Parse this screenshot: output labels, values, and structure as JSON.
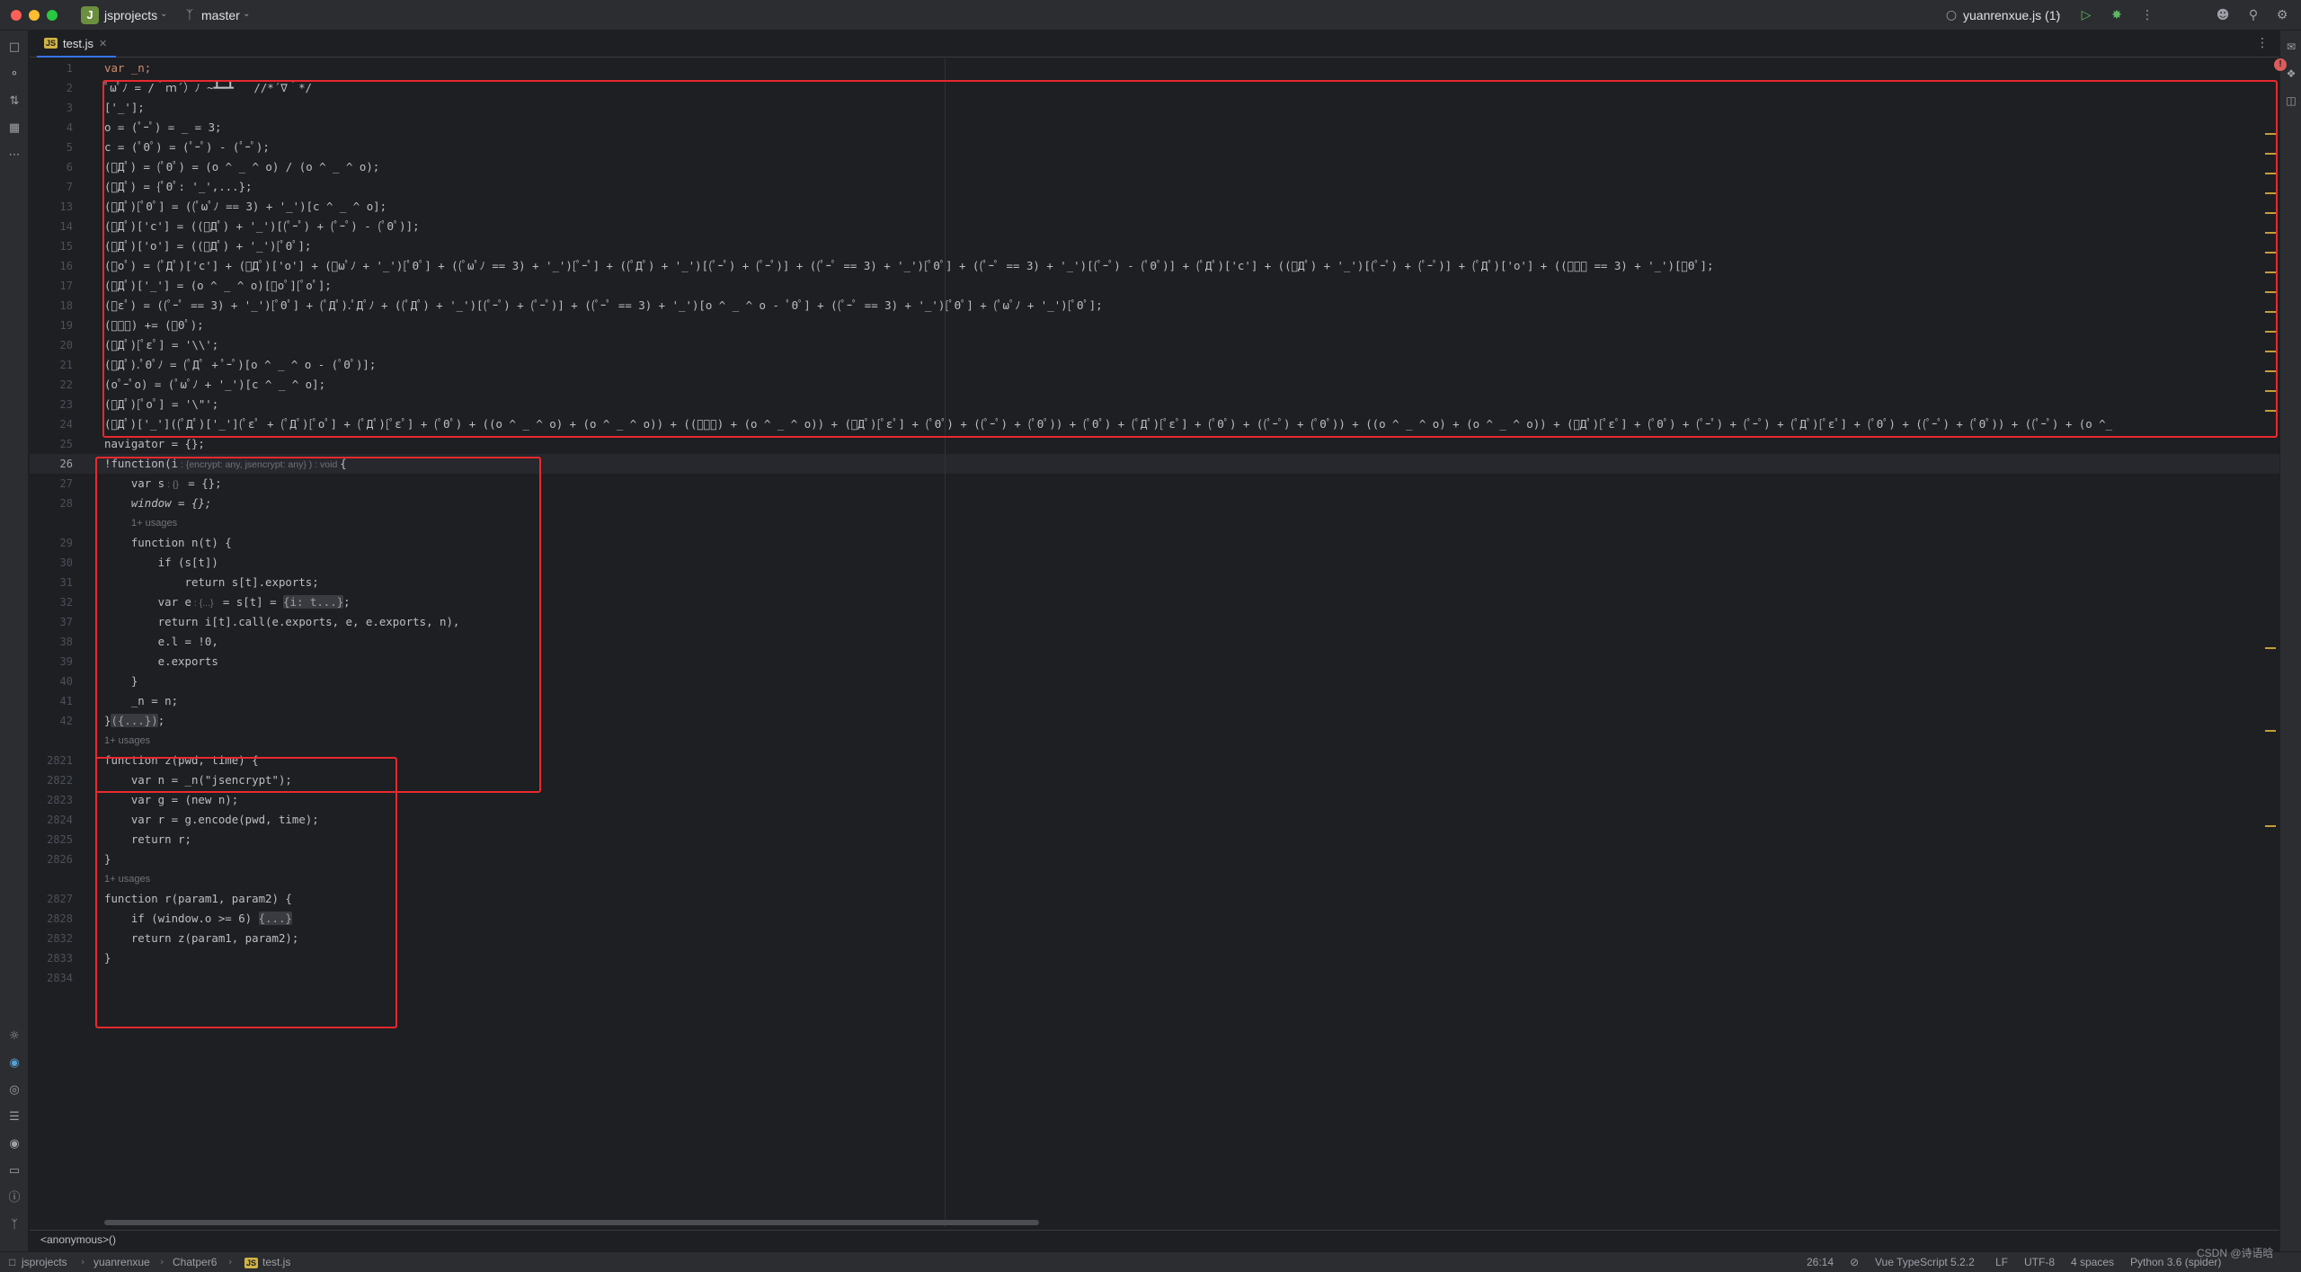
{
  "titlebar": {
    "project_badge": "J",
    "project_name": "jsprojects",
    "branch": "master",
    "run_config": "yuanrenxue.js (1)"
  },
  "tab": {
    "badge": "JS",
    "label": "test.js"
  },
  "breadcrumb_footer": "<anonymous>()",
  "status": {
    "path": [
      "jsprojects",
      "yuanrenxue",
      "Chatper6",
      "test.js"
    ],
    "position": "26:14",
    "language": "Vue TypeScript 5.2.2",
    "line_sep": "LF",
    "encoding": "UTF-8",
    "indent": "4 spaces",
    "interpreter": "Python 3.6 (spider)",
    "watermark": "CSDN @诗语晗"
  },
  "error_count": "!",
  "line_numbers": [
    "1",
    "2",
    "3",
    "4",
    "5",
    "6",
    "7",
    "13",
    "14",
    "15",
    "16",
    "17",
    "18",
    "19",
    "20",
    "21",
    "22",
    "23",
    "24",
    "25",
    "26",
    "27",
    "28",
    "29",
    "30",
    "31",
    "32",
    "37",
    "38",
    "39",
    "40",
    "41",
    "42",
    "2821",
    "2822",
    "2823",
    "2824",
    "2825",
    "2826",
    "2827",
    "2828",
    "2832",
    "2833",
    "2834"
  ],
  "code": {
    "l1": "var _n;",
    "l2": "ﾟωﾟﾉ = /｀ｍ´）ﾉ ~┻━┻   //*´∇｀*/",
    "l3": "['_'];",
    "l4": "o = (ﾟｰﾟ) = _ = 3;",
    "l5": "c = (ﾟΘﾟ) = (ﾟｰﾟ) - (ﾟｰﾟ);",
    "l6": "(ﾟДﾟ) = (ﾟΘﾟ) = (o ^ _ ^ o) / (o ^ _ ^ o);",
    "l7": "(ﾟДﾟ) = {ﾟΘﾟ: '_',...};",
    "l13": "(ﾟДﾟ)[ﾟΘﾟ] = ((ﾟωﾟﾉ == 3) + '_')[c ^ _ ^ o];",
    "l14": "(ﾟДﾟ)['c'] = ((ﾟДﾟ) + '_')[(ﾟｰﾟ) + (ﾟｰﾟ) - (ﾟΘﾟ)];",
    "l15": "(ﾟДﾟ)['o'] = ((ﾟДﾟ) + '_')[ﾟΘﾟ];",
    "l16": "(ﾟoﾟ) = (ﾟДﾟ)['c'] + (ﾟДﾟ)['o'] + (ﾟωﾟﾉ + '_')[ﾟΘﾟ] + ((ﾟωﾟﾉ == 3) + '_')[ﾟｰﾟ] + ((ﾟДﾟ) + '_')[(ﾟｰﾟ) + (ﾟｰﾟ)] + ((ﾟｰﾟ == 3) + '_')[ﾟΘﾟ] + ((ﾟｰﾟ == 3) + '_')[(ﾟｰﾟ) - (ﾟΘﾟ)] + (ﾟДﾟ)['c'] + ((ﾟДﾟ) + '_')[(ﾟｰﾟ) + (ﾟｰﾟ)] + (ﾟДﾟ)['o'] + ((ﾟｰﾟ == 3) + '_')[ﾟΘﾟ];",
    "l17": "(ﾟДﾟ)['_'] = (o ^ _ ^ o)[ﾟoﾟ][ﾟoﾟ];",
    "l18": "(ﾟεﾟ) = ((ﾟｰﾟ == 3) + '_')[ﾟΘﾟ] + (ﾟДﾟ).ﾟДﾟﾉ + ((ﾟДﾟ) + '_')[(ﾟｰﾟ) + (ﾟｰﾟ)] + ((ﾟｰﾟ == 3) + '_')[o ^ _ ^ o - ﾟΘﾟ] + ((ﾟｰﾟ == 3) + '_')[ﾟΘﾟ] + (ﾟωﾟﾉ + '_')[ﾟΘﾟ];",
    "l19": "(ﾟｰﾟ) += (ﾟΘﾟ);",
    "l20": "(ﾟДﾟ)[ﾟεﾟ] = '\\\\';",
    "l21": "(ﾟДﾟ).ﾟΘﾟﾉ = (ﾟДﾟ + ﾟｰﾟ)[o ^ _ ^ o - (ﾟΘﾟ)];",
    "l22": "(oﾟｰﾟo) = (ﾟωﾟﾉ + '_')[c ^ _ ^ o];",
    "l23": "(ﾟДﾟ)[ﾟoﾟ] = '\\\"';",
    "l24": "(ﾟДﾟ)['_']((ﾟДﾟ)['_'](ﾟεﾟ + (ﾟДﾟ)[ﾟoﾟ] + (ﾟДﾟ)[ﾟεﾟ] + (ﾟΘﾟ) + ((o ^ _ ^ o) + (o ^ _ ^ o)) + ((ﾟｰﾟ) + (o ^ _ ^ o)) + (ﾟДﾟ)[ﾟεﾟ] + (ﾟΘﾟ) + ((ﾟｰﾟ) + (ﾟΘﾟ)) + (ﾟΘﾟ) + (ﾟДﾟ)[ﾟεﾟ] + (ﾟΘﾟ) + ((ﾟｰﾟ) + (ﾟΘﾟ)) + ((o ^ _ ^ o) + (o ^ _ ^ o)) + (ﾟДﾟ)[ﾟεﾟ] + (ﾟΘﾟ) + (ﾟｰﾟ) + (ﾟｰﾟ) + (ﾟДﾟ)[ﾟεﾟ] + (ﾟΘﾟ) + ((ﾟｰﾟ) + (ﾟΘﾟ)) + ((ﾟｰﾟ) + (o ^_",
    "l25": "navigator = {};",
    "l26_a": "!function(i",
    "l26_hint": " : {encrypt: any, jsencrypt: any} ) : void ",
    "l26_b": "{",
    "l27_a": "    var s",
    "l27_hint": " : {} ",
    "l27_b": " = {};",
    "l28": "    window = {};",
    "usages1": "1+ usages",
    "l29": "    function n(t) {",
    "l30": "        if (s[t])",
    "l31": "            return s[t].exports;",
    "l32_a": "        var e",
    "l32_hint": " : {...} ",
    "l32_b": " = s[t] = ",
    "l32_fold": "{i: t...}",
    "l32_c": ";",
    "l37": "        return i[t].call(e.exports, e, e.exports, n),",
    "l38": "        e.l = !0,",
    "l39": "        e.exports",
    "l40": "    }",
    "l41": "    _n = n;",
    "l42_a": "}",
    "l42_fold": "({...})",
    "l42_b": ";",
    "usages2": "1+ usages",
    "l2821": "function z(pwd, time) {",
    "l2822": "    var n = _n(\"jsencrypt\");",
    "l2823": "    var g = (new n);",
    "l2824": "    var r = g.encode(pwd, time);",
    "l2825": "    return r;",
    "l2826": "}",
    "usages3": "1+ usages",
    "l2827": "function r(param1, param2) {",
    "l2828_a": "    if (window.o >= 6) ",
    "l2828_fold": "{...}",
    "l2832": "    return z(param1, param2);",
    "l2833": "}",
    "l2834": ""
  },
  "colors": {
    "annotation": "#e8292e",
    "keyword": "#cf8e6d",
    "function": "#56a8f5",
    "string": "#6aab73",
    "number": "#2aacb8",
    "property": "#c77dbb"
  }
}
